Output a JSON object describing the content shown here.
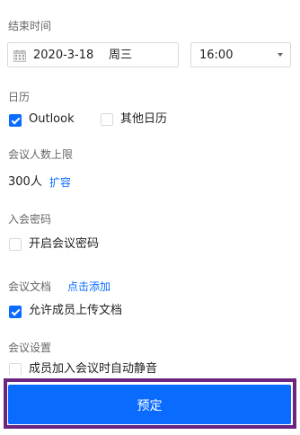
{
  "end_time": {
    "label": "结束时间",
    "date_value": "2020-3-18",
    "weekday": "周三",
    "time_value": "16:00"
  },
  "calendar": {
    "label": "日历",
    "options": [
      {
        "label": "Outlook",
        "checked": true
      },
      {
        "label": "其他日历",
        "checked": false
      }
    ]
  },
  "attendee_limit": {
    "label": "会议人数上限",
    "value": "300人",
    "expand_link": "扩容"
  },
  "password": {
    "label": "入会密码",
    "option_label": "开启会议密码",
    "checked": false
  },
  "documents": {
    "label": "会议文档",
    "add_link": "点击添加",
    "option_label": "允许成员上传文档",
    "checked": true
  },
  "settings": {
    "label": "会议设置",
    "option_label": "成员加入会议时自动静音",
    "checked": false
  },
  "action": {
    "book_label": "预定"
  },
  "colors": {
    "accent": "#0a6cff",
    "highlight_frame": "#6b2580",
    "label_gray": "#666666"
  }
}
